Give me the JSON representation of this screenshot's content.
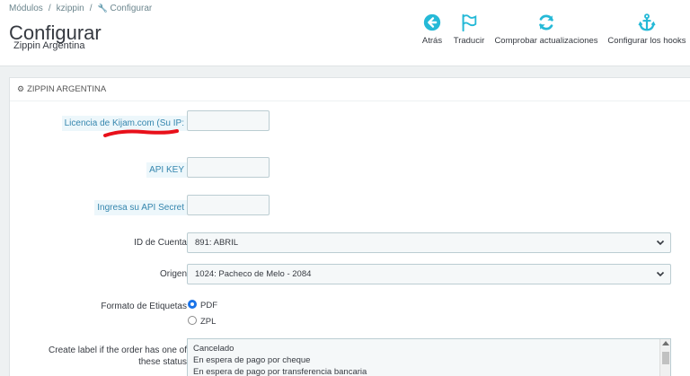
{
  "breadcrumb": {
    "items": [
      "Módulos",
      "kzippin",
      "Configurar"
    ]
  },
  "header": {
    "title": "Configurar",
    "subtitle": "Zippin Argentina"
  },
  "toolbar": {
    "back": "Atrás",
    "translate": "Traducir",
    "check_updates": "Comprobar actualizaciones",
    "configure_hooks": "Configurar los hooks"
  },
  "panel": {
    "title": "ZIPPIN ARGENTINA"
  },
  "form": {
    "license_label": "Licencia de Kijam.com (Su IP:",
    "license_value": "",
    "api_key_label": "API KEY",
    "api_key_value": "",
    "api_secret_label": "Ingresa su API Secret",
    "api_secret_value": "",
    "account_label": "ID de Cuenta",
    "account_value": "891: ABRIL",
    "origin_label": "Origen",
    "origin_value": "1024: Pacheco de Melo - 2084",
    "label_format_label": "Formato de Etiquetas",
    "label_format_options": [
      "PDF",
      "ZPL"
    ],
    "label_format_selected": "PDF",
    "create_label_label_line1": "Create label if the order has one of",
    "create_label_label_line2": "these status",
    "status_options": [
      "Cancelado",
      "En espera de pago por cheque",
      "En espera de pago por transferencia bancaria"
    ]
  },
  "colors": {
    "accent": "#25b9d7",
    "hint_text": "#3586ae",
    "annotation": "#e8101a"
  },
  "icons": {
    "back": "arrow-left-circle-icon",
    "translate": "flag-icon",
    "check_updates": "refresh-icon",
    "configure_hooks": "anchor-icon",
    "panel": "gears-icon",
    "breadcrumb": "wrench-icon"
  }
}
